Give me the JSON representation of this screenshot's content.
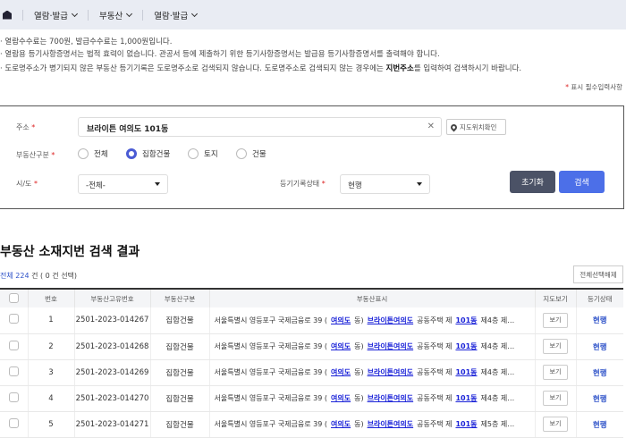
{
  "nav": {
    "items": [
      "열람·발급",
      "부동산",
      "열람·발급"
    ]
  },
  "notes": {
    "n1": "· 열람수수료는 700원, 발급수수료는 1,000원입니다.",
    "n2": "· 열람용 등기사항증명서는 법적 효력이 없습니다. 관공서 등에 제출하기 위한 등기사항증명서는 발급용 등기사항증명서를 출력해야 합니다.",
    "n3a": "· 도로명주소가 병기되지 않은 부동산 등기기록은 도로명주소로 검색되지 않습니다. 도로명주소로 검색되지 않는 경우에는 ",
    "n3b": "지번주소",
    "n3c": "를 입력하여 검색하시기 바랍니다.",
    "required": "표시 필수입력사항"
  },
  "form": {
    "address_label": "주소",
    "address_value": "브라이튼 여의도 101동",
    "map_button": "지도위치확인",
    "type_label": "부동산구분",
    "types": [
      "전체",
      "집합건물",
      "토지",
      "건물"
    ],
    "selected_type": "집합건물",
    "sido_label": "시/도",
    "sido_value": "-전체-",
    "status_label": "등기기록상태",
    "status_value": "현행",
    "reset": "초기화",
    "search": "검색"
  },
  "results": {
    "title": "부동산 소재지번 검색 결과",
    "count_prefix": "전체 ",
    "count": "224",
    "count_suffix": " 건 ( 0 건 선택)",
    "deselect": "전체선택해제",
    "headers": [
      "번호",
      "부동산고유번호",
      "부동산구분",
      "부동산표시",
      "지도보기",
      "등기상태"
    ],
    "rows": [
      {
        "no": "1",
        "id": "2501-2023-014267",
        "type": "집합건물",
        "a1": "서울특별시 영등포구 국제금융로 39 (",
        "dong": "여의도",
        "a2": "동)",
        "bld": "브라이튼여의도",
        "a3": "공동주택 제",
        "unit": "101동",
        "a4": "제4층 제…",
        "view": "보기",
        "status": "현행"
      },
      {
        "no": "2",
        "id": "2501-2023-014268",
        "type": "집합건물",
        "a1": "서울특별시 영등포구 국제금융로 39 (",
        "dong": "여의도",
        "a2": "동)",
        "bld": "브라이튼여의도",
        "a3": "공동주택 제",
        "unit": "101동",
        "a4": "제4층 제…",
        "view": "보기",
        "status": "현행"
      },
      {
        "no": "3",
        "id": "2501-2023-014269",
        "type": "집합건물",
        "a1": "서울특별시 영등포구 국제금융로 39 (",
        "dong": "여의도",
        "a2": "동)",
        "bld": "브라이튼여의도",
        "a3": "공동주택 제",
        "unit": "101동",
        "a4": "제4층 제…",
        "view": "보기",
        "status": "현행"
      },
      {
        "no": "4",
        "id": "2501-2023-014270",
        "type": "집합건물",
        "a1": "서울특별시 영등포구 국제금융로 39 (",
        "dong": "여의도",
        "a2": "동)",
        "bld": "브라이튼여의도",
        "a3": "공동주택 제",
        "unit": "101동",
        "a4": "제4층 제…",
        "view": "보기",
        "status": "현행"
      },
      {
        "no": "5",
        "id": "2501-2023-014271",
        "type": "집합건물",
        "a1": "서울특별시 영등포구 국제금융로 39 (",
        "dong": "여의도",
        "a2": "동)",
        "bld": "브라이튼여의도",
        "a3": "공동주택 제",
        "unit": "101동",
        "a4": "제5층 제…",
        "view": "보기",
        "status": "현행"
      }
    ]
  }
}
